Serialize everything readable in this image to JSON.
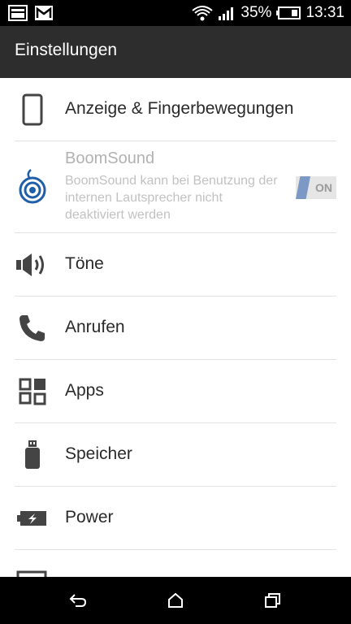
{
  "status_bar": {
    "battery": "35%",
    "time": "13:31",
    "icons": [
      "gallery-icon",
      "gmail-icon",
      "wifi-icon",
      "signal-icon",
      "battery-icon"
    ]
  },
  "header": {
    "title": "Einstellungen"
  },
  "items": [
    {
      "label": "Anzeige & Fingerbewegungen",
      "icon": "phone-display-icon"
    },
    {
      "title": "BoomSound",
      "description": "BoomSound kann bei Benutzung der internen Lautsprecher nicht deaktiviert werden",
      "toggle": "ON",
      "icon": "boomsound-icon"
    },
    {
      "label": "Töne",
      "icon": "speaker-icon"
    },
    {
      "label": "Anrufen",
      "icon": "phone-handset-icon"
    },
    {
      "label": "Apps",
      "icon": "apps-grid-icon"
    },
    {
      "label": "Speicher",
      "icon": "usb-storage-icon"
    },
    {
      "label": "Power",
      "icon": "battery-power-icon"
    }
  ],
  "nav_bar": {
    "icons": [
      "back-icon",
      "home-icon",
      "recents-icon"
    ]
  },
  "colors": {
    "status_bar": "#000000",
    "action_bar": "#2d2d2d",
    "toggle_accent": "#7b99c4",
    "boomsound_icon": "#1f5fa8"
  }
}
